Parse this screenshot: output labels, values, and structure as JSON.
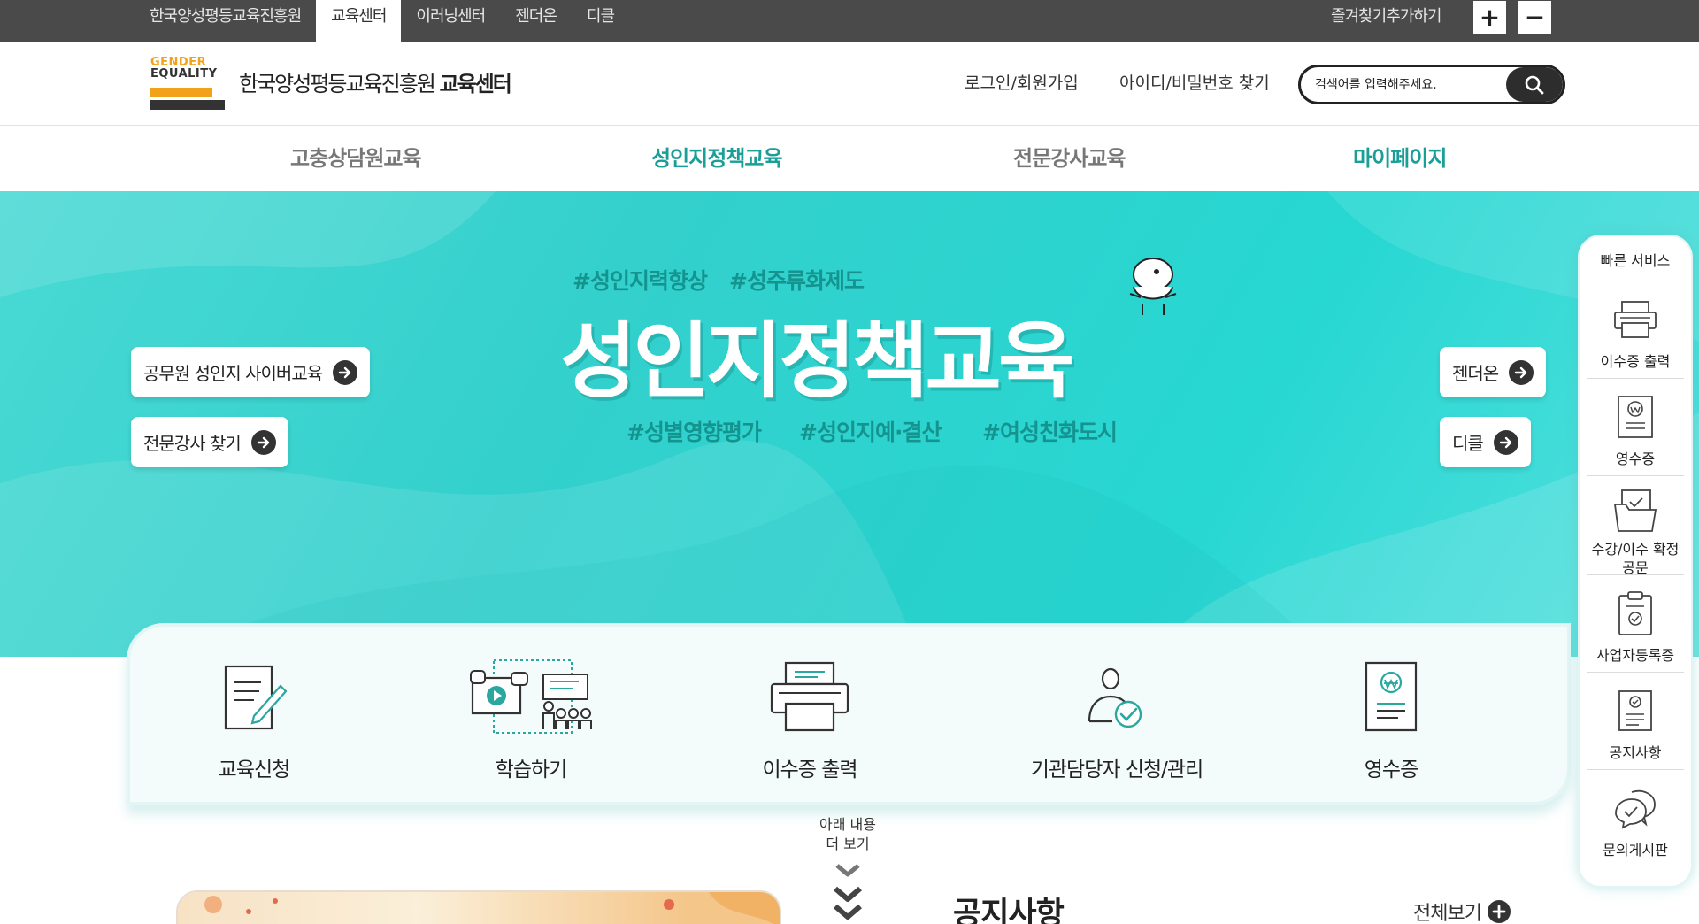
{
  "topbar": {
    "site_links": [
      "한국양성평등교육진흥원",
      "교육센터",
      "이러닝센터",
      "젠더온",
      "디클"
    ],
    "active_index": 1,
    "bookmark": "즐겨찾기추가하기",
    "zoom_in": "+",
    "zoom_out": "−"
  },
  "header": {
    "logo_line1": "GENDER",
    "logo_line2": "EQUALITY",
    "title_prefix": "한국양성평등교육진흥원",
    "title_bold": "교육센터",
    "login": "로그인/회원가입",
    "find_account": "아이디/비밀번호 찾기",
    "search_placeholder": "검색어를 입력해주세요."
  },
  "gnb": {
    "items": [
      "고충상담원교육",
      "성인지정책교육",
      "전문강사교육",
      "마이페이지"
    ],
    "colors": [
      "#777777",
      "#1a9e98",
      "#777777",
      "#1a9e98"
    ]
  },
  "hero": {
    "tags_top": [
      "#성인지력향상",
      "#성주류화제도"
    ],
    "title": "성인지정책교육",
    "tags_bottom": [
      "#성별영향평가",
      "#성인지예·결산",
      "#여성친화도시"
    ],
    "left_buttons": [
      "공무원 성인지 사이버교육",
      "전문강사 찾기"
    ],
    "right_buttons": [
      "젠더온",
      "디클"
    ]
  },
  "quick_menu": {
    "items": [
      "교육신청",
      "학습하기",
      "이수증 출력",
      "기관담당자 신청/관리",
      "영수증"
    ]
  },
  "scroll_hint": {
    "line1": "아래 내용",
    "line2": "더 보기"
  },
  "notice": {
    "title": "공지사항",
    "view_all": "전체보기"
  },
  "quick_panel": {
    "title": "빠른 서비스",
    "items": [
      "이수증 출력",
      "영수증",
      "수강/이수 확정\n공문",
      "사업자등록증",
      "공지사항",
      "문의게시판"
    ]
  },
  "colors": {
    "accent_teal": "#1a9e98",
    "hero_bg": "#2fd3cf",
    "topbar_bg": "#4a4a4a",
    "logo_orange": "#f2a21a"
  }
}
